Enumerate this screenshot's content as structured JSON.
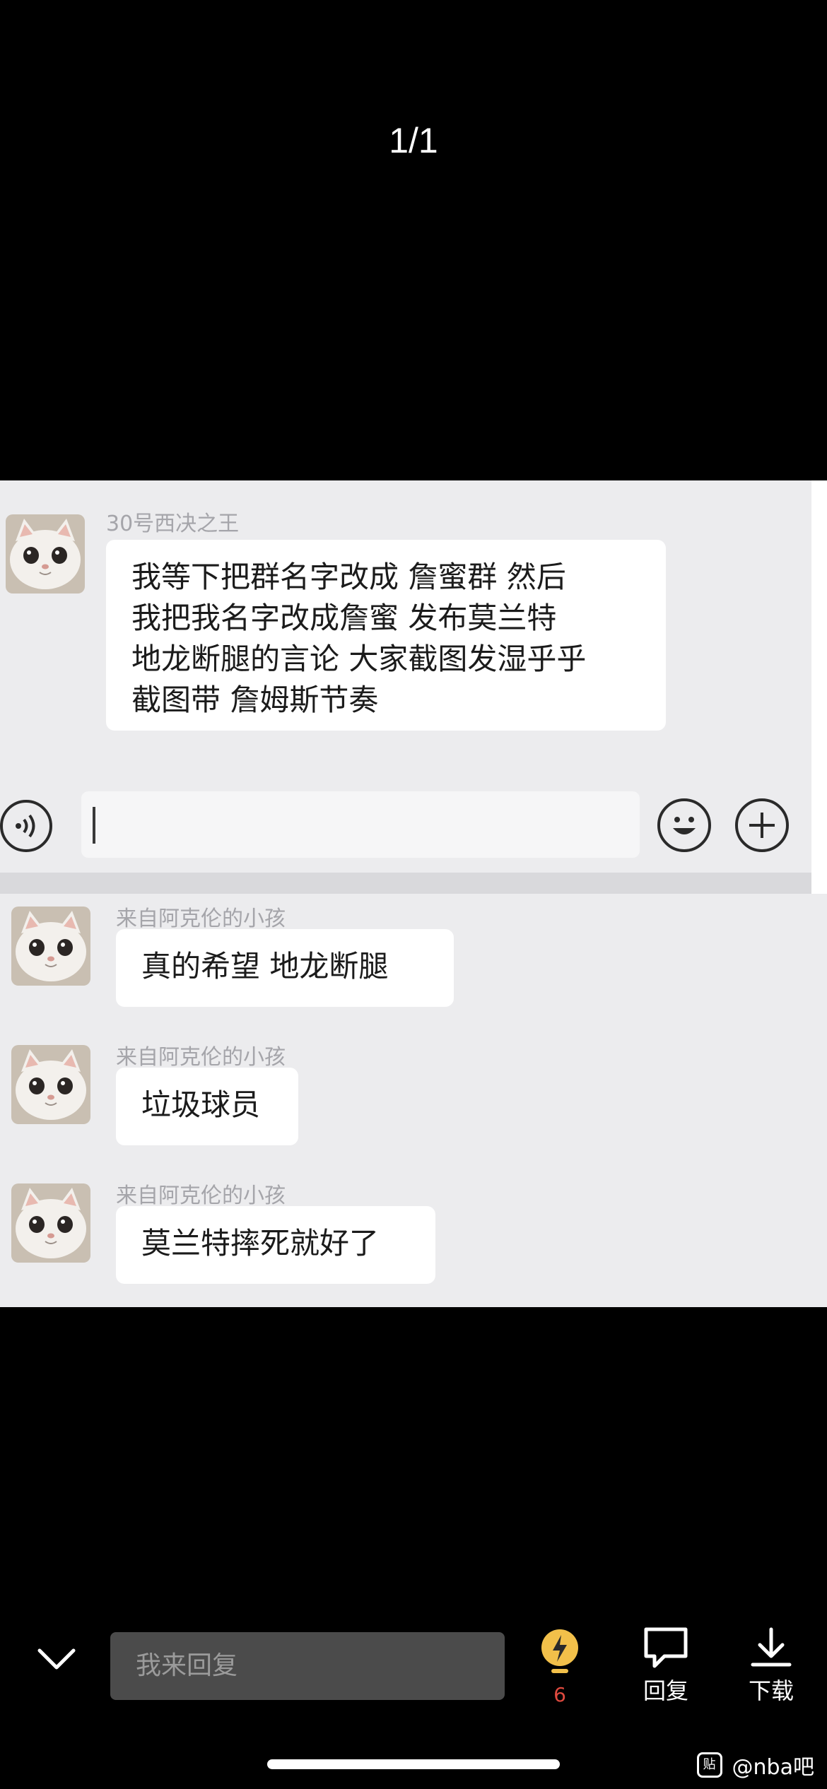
{
  "viewer": {
    "counter": "1/1"
  },
  "screenshot": {
    "top_chat": {
      "sender": "30号西决之王",
      "message_lines": [
        "我等下把群名字改成 詹蜜群  然后",
        "我把我名字改成詹蜜  发布莫兰特",
        "地龙断腿的言论 大家截图发湿乎乎",
        "截图带 詹姆斯节奏"
      ]
    },
    "input_bar": {
      "voice_icon": "voice-icon",
      "emoji_icon": "emoji-icon",
      "plus_icon": "plus-icon"
    },
    "bottom_chat": [
      {
        "sender": "来自阿克伦的小孩",
        "text": "真的希望 地龙断腿"
      },
      {
        "sender": "来自阿克伦的小孩",
        "text": "垃圾球员"
      },
      {
        "sender": "来自阿克伦的小孩",
        "text": "莫兰特摔死就好了"
      }
    ]
  },
  "bottom_bar": {
    "reply_placeholder": "我来回复",
    "boost_count": "6",
    "reply_label": "回复",
    "download_label": "下载",
    "accent_color": "#e04a3f"
  },
  "watermark": {
    "logo_text": "贴",
    "text": "@nba吧"
  }
}
